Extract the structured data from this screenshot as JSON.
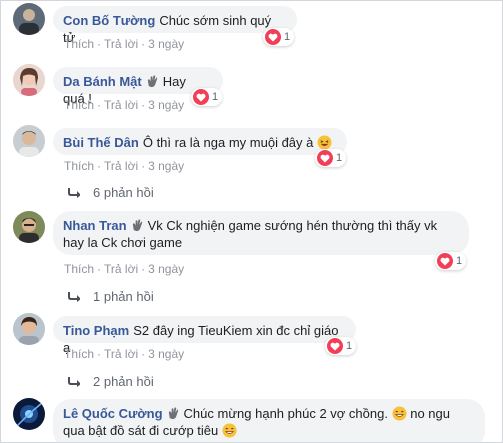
{
  "actions": {
    "like": "Thích",
    "reply": "Trả lời",
    "sep": "·"
  },
  "colors": {
    "author": "#385898",
    "bubble": "#f2f3f5",
    "heart": "#f33e58",
    "meta": "#90949c"
  },
  "comments": [
    {
      "author": "Con Bố Tường",
      "text": "Chúc sớm sinh quý tử",
      "reaction_count": "1",
      "time": "3 ngày"
    },
    {
      "author": "Da Bánh Mật",
      "text": "Hay quá !",
      "reaction_count": "1",
      "time": "3 ngày"
    },
    {
      "author": "Bùi Thế Dân",
      "text": "Ô thì ra là nga my muội đây à",
      "reaction_count": "1",
      "time": "3 ngày",
      "replies": "6 phản hồi"
    },
    {
      "author": "Nhan Tran",
      "text": "Vk Ck nghiện game sướng hén thường thì thấy vk",
      "text2": "hay la Ck chơi game",
      "reaction_count": "1",
      "time": "3 ngày",
      "replies": "1 phản hồi"
    },
    {
      "author": "Tino Phạm",
      "text": "S2 đây ing TieuKiem xin đc chỉ giáo ạ",
      "reaction_count": "1",
      "time": "3 ngày",
      "replies": "2 phản hồi"
    },
    {
      "author": "Lê Quốc Cường",
      "text": "Chúc mừng hạnh phúc 2 vợ chồng.",
      "text_b": "no ngu",
      "text2": "qua bật đồ sát đi cướp tiêu"
    }
  ]
}
